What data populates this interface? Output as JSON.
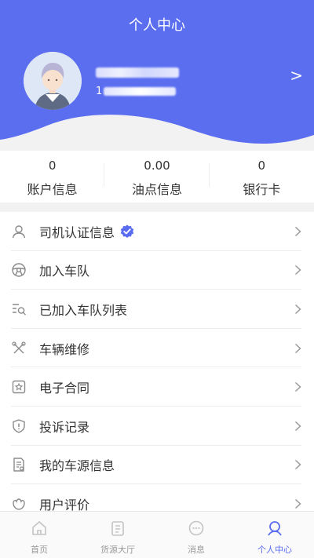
{
  "header": {
    "title": "个人中心",
    "phone_visible_prefix": "1",
    "arrow": ">"
  },
  "stats": [
    {
      "value": "0",
      "label": "账户信息"
    },
    {
      "value": "0.00",
      "label": "油点信息"
    },
    {
      "value": "0",
      "label": "银行卡"
    }
  ],
  "menu": [
    {
      "label": "司机认证信息",
      "icon": "user-icon",
      "verified": true
    },
    {
      "label": "加入车队",
      "icon": "steering-wheel-icon"
    },
    {
      "label": "已加入车队列表",
      "icon": "list-search-icon"
    },
    {
      "label": "车辆维修",
      "icon": "wrench-icon"
    },
    {
      "label": "电子合同",
      "icon": "contract-icon"
    },
    {
      "label": "投诉记录",
      "icon": "shield-alert-icon"
    },
    {
      "label": "我的车源信息",
      "icon": "document-icon"
    },
    {
      "label": "用户评价",
      "icon": "flower-icon"
    }
  ],
  "tabs": [
    {
      "label": "首页",
      "icon": "home-icon",
      "active": false
    },
    {
      "label": "货源大厅",
      "icon": "cargo-doc-icon",
      "active": false
    },
    {
      "label": "消息",
      "icon": "chat-icon",
      "active": false
    },
    {
      "label": "个人中心",
      "icon": "profile-icon",
      "active": true
    }
  ],
  "colors": {
    "accent": "#5a6cf2",
    "header_bg": "#5b6ef0",
    "icon_gray": "#8a8a8a"
  }
}
